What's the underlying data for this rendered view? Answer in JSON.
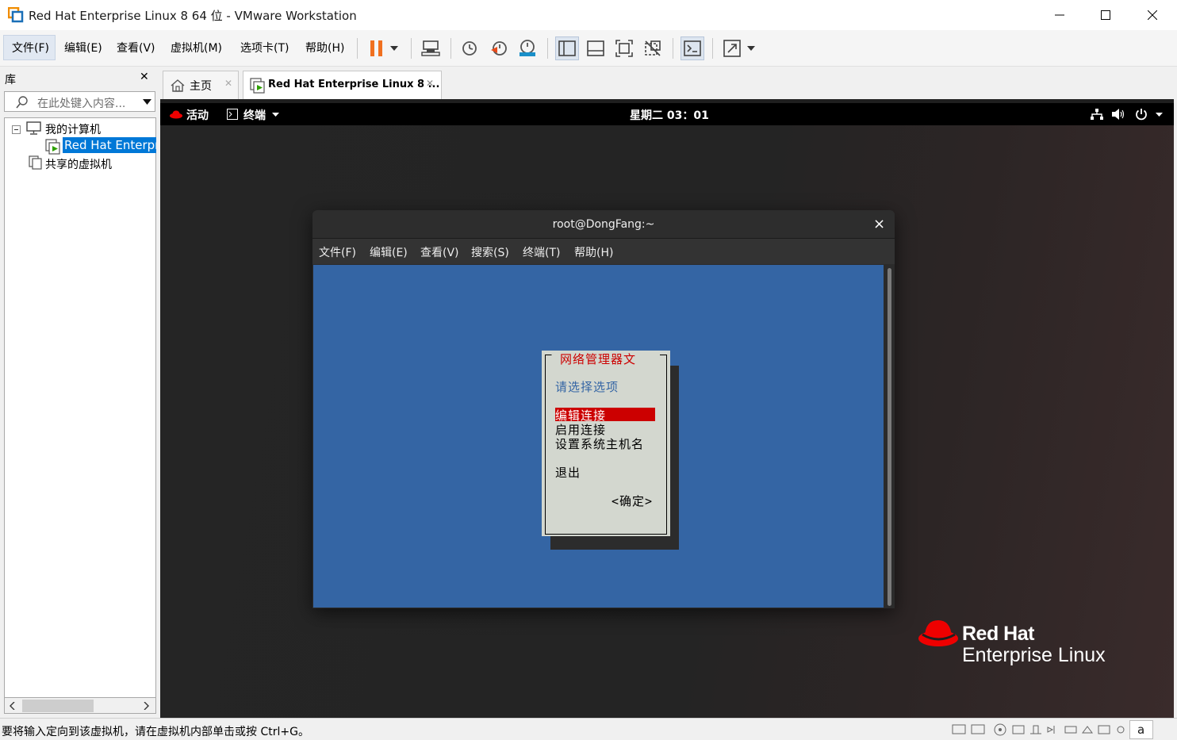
{
  "window": {
    "title": "Red Hat Enterprise Linux 8 64 位 - VMware Workstation",
    "minimize": "—",
    "maximize": "☐",
    "close": "✕"
  },
  "menubar": {
    "items": [
      "文件(F)",
      "编辑(E)",
      "查看(V)",
      "虚拟机(M)",
      "选项卡(T)",
      "帮助(H)"
    ]
  },
  "library": {
    "title": "库",
    "close": "✕",
    "search_placeholder": "在此处键入内容...",
    "tree": {
      "my_computer": "我的计算机",
      "vm_item": "Red Hat Enterpr",
      "shared": "共享的虚拟机",
      "collapse_glyph": "⊟"
    }
  },
  "tabs": [
    {
      "label": "主页",
      "close": "✕"
    },
    {
      "label": "Red Hat Enterprise Linux 8 ...",
      "close": "✕"
    }
  ],
  "gnome": {
    "activities": "活动",
    "app_menu": "终端",
    "clock": "星期二 03：01"
  },
  "terminal": {
    "title": "root@DongFang:~",
    "close": "×",
    "menu": [
      "文件(F)",
      "编辑(E)",
      "查看(V)",
      "搜索(S)",
      "终端(T)",
      "帮助(H)"
    ]
  },
  "nmtui": {
    "title": "网络管理器文",
    "prompt": "请选择选项",
    "options": [
      "编辑连接",
      "启用连接",
      "设置系统主机名"
    ],
    "quit": "退出",
    "ok": "<确定>",
    "colors": {
      "title": "#cc0000",
      "prompt": "#3465a4",
      "selected_bg": "#cc0000",
      "selected_fg": "#ffffff"
    }
  },
  "branding": {
    "line1": "Red Hat",
    "line2": "Enterprise Linux"
  },
  "statusbar": {
    "message": "要将输入定向到该虚拟机，请在虚拟机内部单击或按 Ctrl+G。",
    "ime": "a"
  },
  "colors": {
    "accent_red": "#ee0000",
    "pause_orange": "#f07020",
    "vm_selected_bg": "#0078d7",
    "terminal_bg": "#3465a4"
  }
}
